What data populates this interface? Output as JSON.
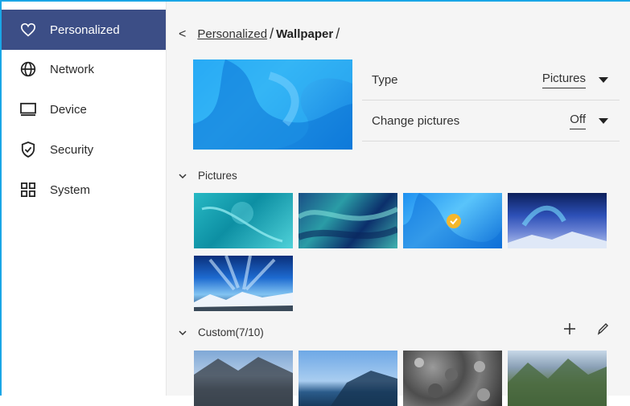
{
  "sidebar": {
    "items": [
      {
        "label": "Personalized",
        "icon": "heart-icon",
        "active": true
      },
      {
        "label": "Network",
        "icon": "globe-icon",
        "active": false
      },
      {
        "label": "Device",
        "icon": "monitor-icon",
        "active": false
      },
      {
        "label": "Security",
        "icon": "shield-check-icon",
        "active": false
      },
      {
        "label": "System",
        "icon": "grid-icon",
        "active": false
      }
    ]
  },
  "breadcrumb": {
    "back_icon": "chevron-left-icon",
    "parent": "Personalized",
    "separator": "/",
    "current": "Wallpaper"
  },
  "settings": {
    "type": {
      "label": "Type",
      "value": "Pictures"
    },
    "change_pictures": {
      "label": "Change pictures",
      "value": "Off"
    }
  },
  "sections": {
    "pictures": {
      "label": "Pictures"
    },
    "custom": {
      "label": "Custom(7/10)"
    }
  },
  "colors": {
    "sidebar_active": "#3c4e86",
    "accent_border": "#1aa6e6",
    "selected_check": "#f4b72b"
  }
}
